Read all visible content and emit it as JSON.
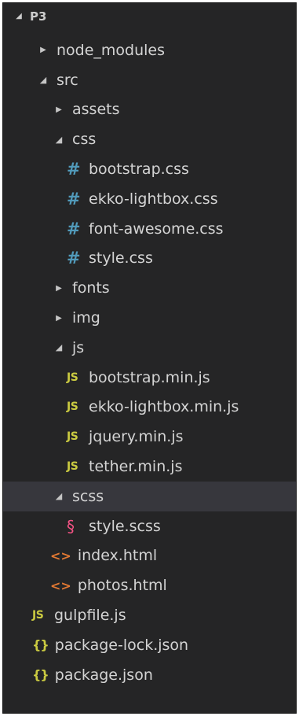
{
  "explorer": {
    "root": {
      "label": "P3",
      "expanded": true
    },
    "items": [
      {
        "label": "node_modules",
        "kind": "folder",
        "depth": 1,
        "expanded": false
      },
      {
        "label": "src",
        "kind": "folder",
        "depth": 1,
        "expanded": true
      },
      {
        "label": "assets",
        "kind": "folder",
        "depth": 2,
        "expanded": false
      },
      {
        "label": "css",
        "kind": "folder",
        "depth": 2,
        "expanded": true
      },
      {
        "label": "bootstrap.css",
        "kind": "css",
        "depth": 3,
        "icon_text": "#"
      },
      {
        "label": "ekko-lightbox.css",
        "kind": "css",
        "depth": 3,
        "icon_text": "#"
      },
      {
        "label": "font-awesome.css",
        "kind": "css",
        "depth": 3,
        "icon_text": "#"
      },
      {
        "label": "style.css",
        "kind": "css",
        "depth": 3,
        "icon_text": "#"
      },
      {
        "label": "fonts",
        "kind": "folder",
        "depth": 2,
        "expanded": false
      },
      {
        "label": "img",
        "kind": "folder",
        "depth": 2,
        "expanded": false
      },
      {
        "label": "js",
        "kind": "folder",
        "depth": 2,
        "expanded": true
      },
      {
        "label": "bootstrap.min.js",
        "kind": "js",
        "depth": 3,
        "icon_text": "JS"
      },
      {
        "label": "ekko-lightbox.min.js",
        "kind": "js",
        "depth": 3,
        "icon_text": "JS"
      },
      {
        "label": "jquery.min.js",
        "kind": "js",
        "depth": 3,
        "icon_text": "JS"
      },
      {
        "label": "tether.min.js",
        "kind": "js",
        "depth": 3,
        "icon_text": "JS"
      },
      {
        "label": "scss",
        "kind": "folder",
        "depth": 2,
        "expanded": true,
        "selected": true
      },
      {
        "label": "style.scss",
        "kind": "scss",
        "depth": 3,
        "icon_text": "§"
      },
      {
        "label": "index.html",
        "kind": "html",
        "depth": 2,
        "icon_text": "<>"
      },
      {
        "label": "photos.html",
        "kind": "html",
        "depth": 2,
        "icon_text": "<>"
      },
      {
        "label": "gulpfile.js",
        "kind": "js",
        "depth": 1,
        "icon_text": "JS"
      },
      {
        "label": "package-lock.json",
        "kind": "json",
        "depth": 1,
        "icon_text": "{}"
      },
      {
        "label": "package.json",
        "kind": "json",
        "depth": 1,
        "icon_text": "{}"
      }
    ]
  },
  "colors": {
    "background": "#252526",
    "selected_row": "#37373d",
    "text": "#d4d4d4",
    "css_icon": "#519aba",
    "js_icon": "#cbcb41",
    "html_icon": "#e37933",
    "json_icon": "#cbcb41",
    "scss_icon": "#f55385"
  }
}
